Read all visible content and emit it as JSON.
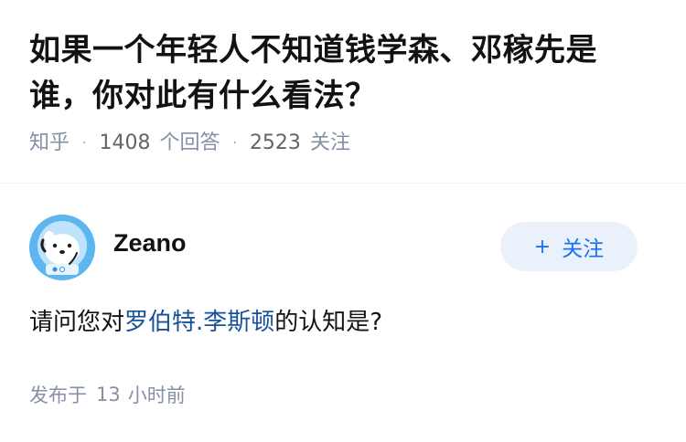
{
  "question": {
    "title": "如果一个年轻人不知道钱学森、邓稼先是谁，你对此有什么看法？",
    "source": "知乎",
    "separator": "·",
    "answer_count": "1408",
    "answer_label": "个回答",
    "follower_count": "2523",
    "follower_label": "关注"
  },
  "answer": {
    "author": {
      "name": "Zeano",
      "avatar_icon": "astronaut-dog-avatar-icon"
    },
    "follow_button": {
      "plus": "+",
      "label": "关注"
    },
    "content": {
      "before_link": "请问您对",
      "link": "罗伯特.李斯顿",
      "after_link": "的认知是?"
    },
    "published": {
      "prefix": "发布于",
      "amount": "13",
      "suffix": "小时前"
    }
  },
  "colors": {
    "accent": "#1772f6",
    "link": "#175199",
    "meta": "#8590a6",
    "button_bg": "#ebf1fb"
  }
}
